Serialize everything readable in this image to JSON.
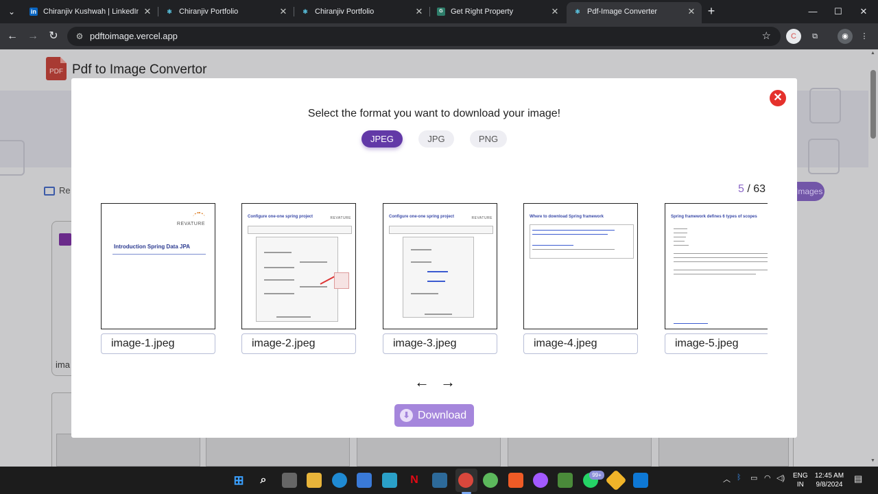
{
  "browser": {
    "tabs": [
      {
        "title": "Chiranjiv Kushwah | LinkedIn",
        "icon": "linkedin-icon",
        "active": false
      },
      {
        "title": "Chiranjiv Portfolio",
        "icon": "react-icon",
        "active": false
      },
      {
        "title": "Chiranjiv Portfolio",
        "icon": "react-icon",
        "active": false
      },
      {
        "title": "Get Right Property",
        "icon": "property-icon",
        "active": false
      },
      {
        "title": "Pdf-Image Converter",
        "icon": "react-icon",
        "active": true
      }
    ],
    "url": "pdftoimage.vercel.app"
  },
  "app": {
    "logo_text": "PDF",
    "title": "Pdf to Image Convertor",
    "reupload_label": "Re",
    "images_label": "Images",
    "card_label": "ima"
  },
  "modal": {
    "prompt": "Select the format you want to download your image!",
    "formats": [
      {
        "label": "JPEG",
        "selected": true
      },
      {
        "label": "JPG",
        "selected": false
      },
      {
        "label": "PNG",
        "selected": false
      }
    ],
    "counter": {
      "current": "5",
      "separator": "/",
      "total": "63"
    },
    "images": [
      {
        "filename": "image-1.jpeg",
        "heading": "Introduction Spring Data JPA",
        "brand": "REVATURE"
      },
      {
        "filename": "image-2.jpeg",
        "heading": "Configure one-one spring project",
        "brand": "REVATURE"
      },
      {
        "filename": "image-3.jpeg",
        "heading": "Configure one-one spring project",
        "brand": "REVATURE"
      },
      {
        "filename": "image-4.jpeg",
        "heading": "Where to download Spring framework",
        "brand": ""
      },
      {
        "filename": "image-5.jpeg",
        "heading": "Spring framework defines 6 types of scopes",
        "brand": ""
      }
    ],
    "prev_arrow": "←",
    "next_arrow": "→",
    "download_label": "Download"
  },
  "taskbar": {
    "language": "ENG",
    "region": "IN",
    "time": "12:45 AM",
    "date": "9/8/2024",
    "whatsapp_badge": "99+"
  },
  "colors": {
    "accent": "#6239a7",
    "download": "#a586dc",
    "close": "#e5312c"
  }
}
